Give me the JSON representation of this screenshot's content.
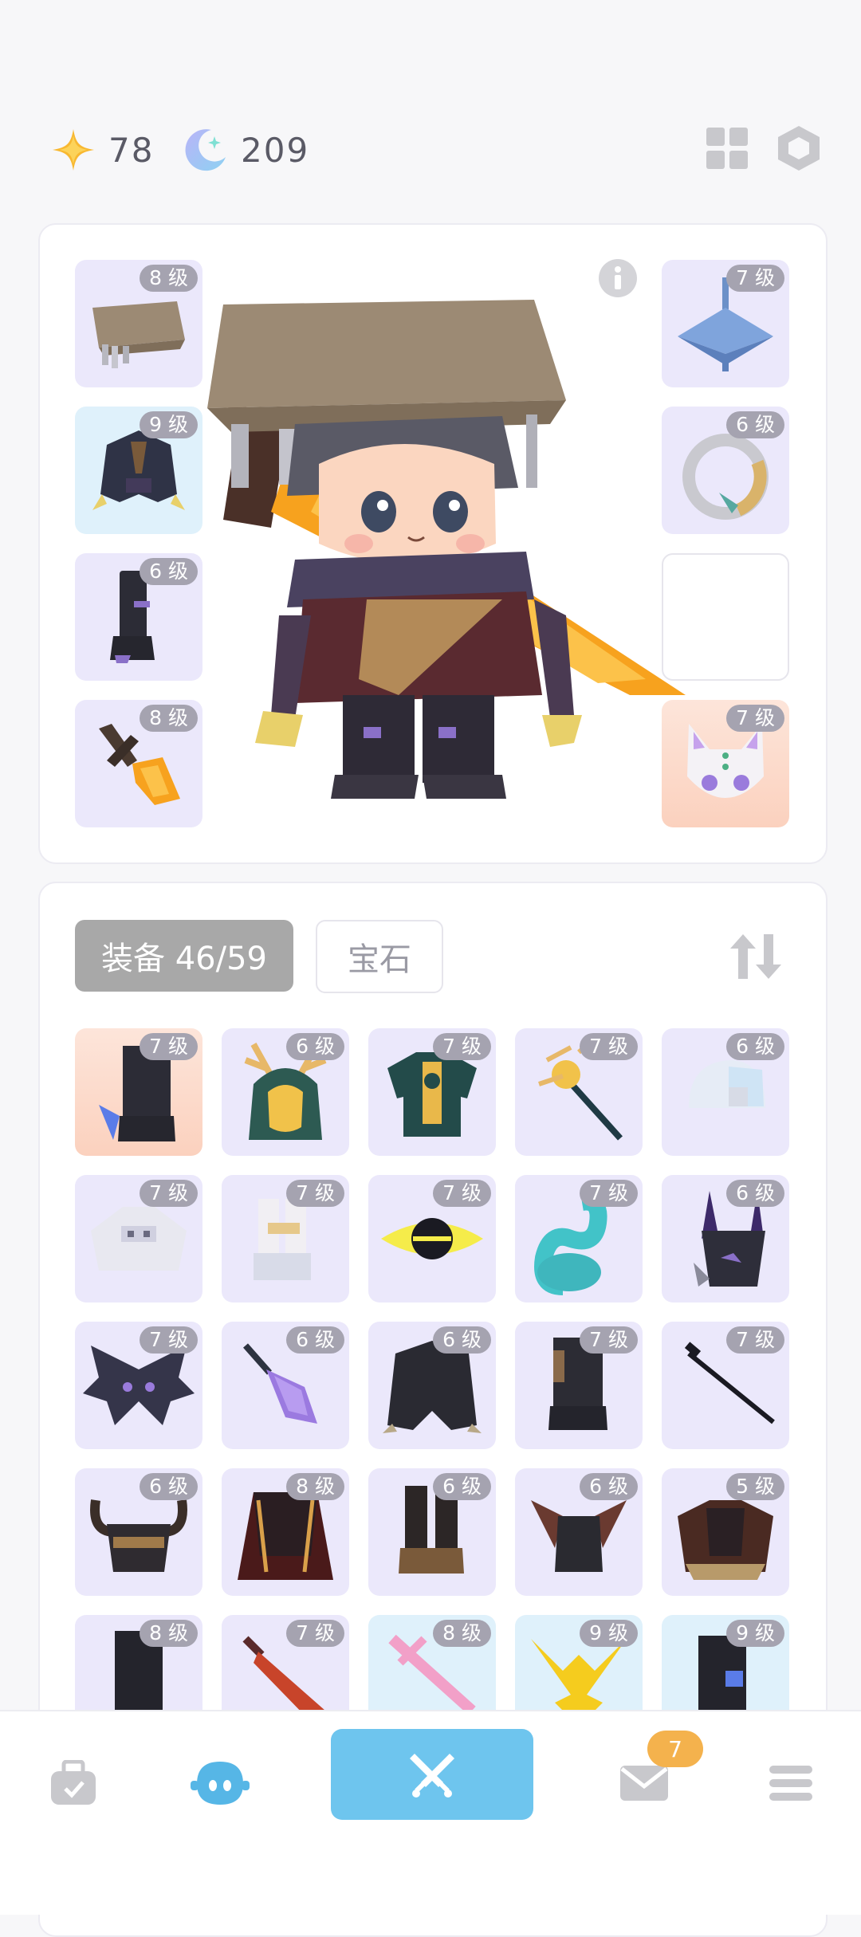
{
  "currency": {
    "star": {
      "icon": "star-icon",
      "value": "78"
    },
    "moon": {
      "icon": "moon-icon",
      "value": "209"
    }
  },
  "top_icons": [
    "grid-icon",
    "hexagon-settings-icon"
  ],
  "equipped": {
    "left": [
      {
        "name": "hat",
        "level": "8 级"
      },
      {
        "name": "armor",
        "level": "9 级"
      },
      {
        "name": "boots",
        "level": "6 级"
      },
      {
        "name": "weapon",
        "level": "8 级"
      }
    ],
    "right": [
      {
        "name": "spinning-top",
        "level": "7 级"
      },
      {
        "name": "ring",
        "level": "6 级"
      },
      {
        "name": "empty",
        "level": ""
      },
      {
        "name": "pet-mask",
        "level": "7 级"
      }
    ]
  },
  "inventory": {
    "tabs": {
      "equip": "装备 46/59",
      "gem": "宝石"
    },
    "items": [
      "7 级",
      "6 级",
      "7 级",
      "7 级",
      "6 级",
      "7 级",
      "7 级",
      "7 级",
      "7 级",
      "6 级",
      "7 级",
      "6 级",
      "6 级",
      "7 级",
      "7 级",
      "6 级",
      "8 级",
      "6 级",
      "6 级",
      "5 级",
      "8 级",
      "7 级",
      "8 级",
      "9 级",
      "9 级"
    ]
  },
  "nav": {
    "items": [
      "bag-icon",
      "character-icon",
      "battle-swords-icon",
      "mail-icon",
      "menu-icon"
    ],
    "mail_badge": "7"
  },
  "colors": {
    "accent": "#6ec5ee",
    "slot_purple": "#ebe8fb",
    "slot_blue": "#dff1fb",
    "slot_orange": "#fbd1be",
    "badge": "#f4b24d"
  }
}
